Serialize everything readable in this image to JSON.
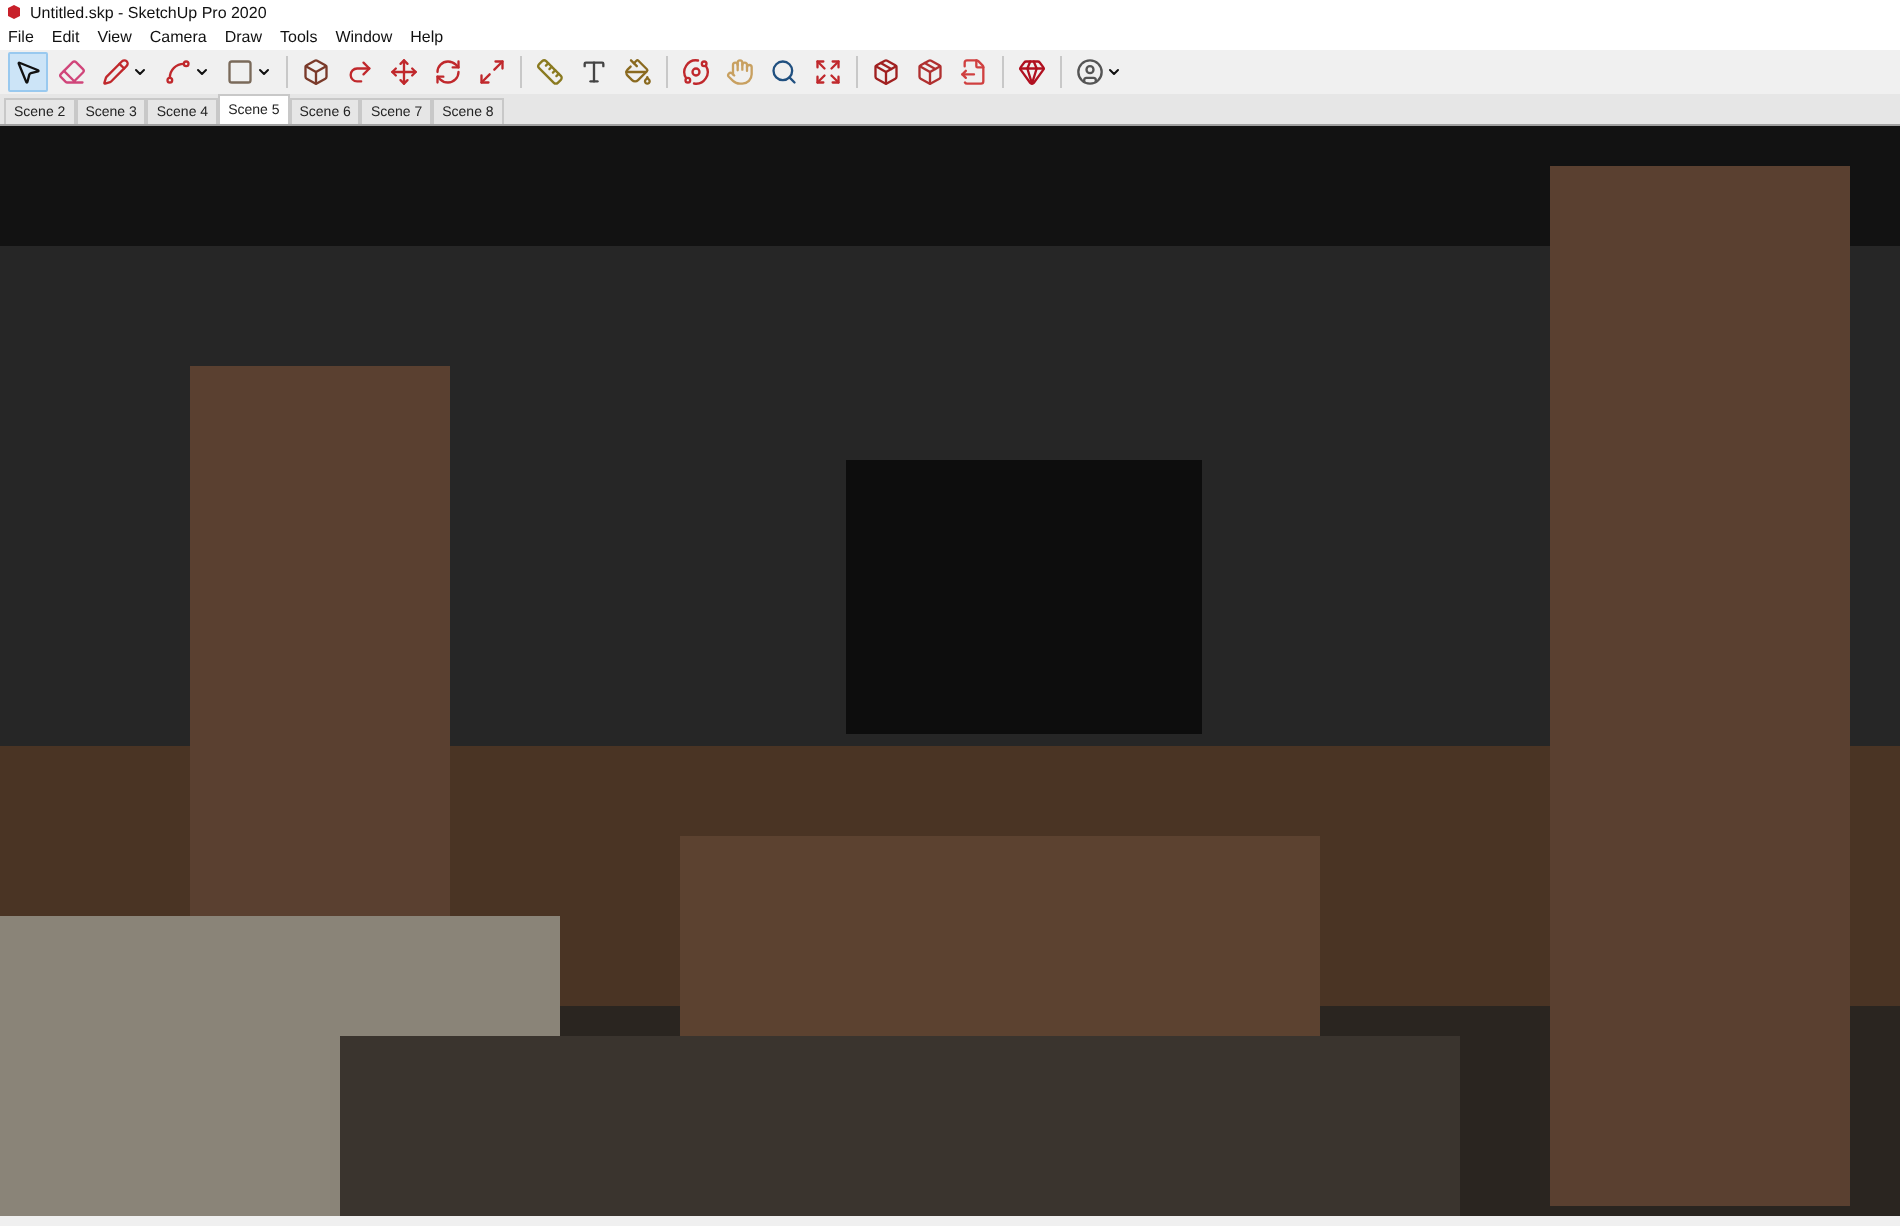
{
  "window": {
    "title": "Untitled.skp - SketchUp Pro 2020"
  },
  "menu": [
    "File",
    "Edit",
    "View",
    "Camera",
    "Draw",
    "Tools",
    "Window",
    "Help"
  ],
  "toolbar": [
    {
      "kind": "select",
      "selected": true,
      "menu": false
    },
    {
      "kind": "eraser",
      "selected": false,
      "menu": false
    },
    {
      "kind": "pencil",
      "selected": false,
      "menu": true
    },
    {
      "kind": "arc",
      "selected": false,
      "menu": true
    },
    {
      "kind": "rectangle",
      "selected": false,
      "menu": true
    },
    {
      "kind": "sep"
    },
    {
      "kind": "pushpull",
      "selected": false,
      "menu": false
    },
    {
      "kind": "followme",
      "selected": false,
      "menu": false
    },
    {
      "kind": "move",
      "selected": false,
      "menu": false
    },
    {
      "kind": "rotate",
      "selected": false,
      "menu": false
    },
    {
      "kind": "scale",
      "selected": false,
      "menu": false
    },
    {
      "kind": "sep"
    },
    {
      "kind": "tape",
      "selected": false,
      "menu": false
    },
    {
      "kind": "text",
      "selected": false,
      "menu": false
    },
    {
      "kind": "paint",
      "selected": false,
      "menu": false
    },
    {
      "kind": "sep"
    },
    {
      "kind": "orbit",
      "selected": false,
      "menu": false
    },
    {
      "kind": "pan",
      "selected": false,
      "menu": false
    },
    {
      "kind": "zoom",
      "selected": false,
      "menu": false
    },
    {
      "kind": "extents",
      "selected": false,
      "menu": false
    },
    {
      "kind": "sep"
    },
    {
      "kind": "warehouse",
      "selected": false,
      "menu": false
    },
    {
      "kind": "extension",
      "selected": false,
      "menu": false
    },
    {
      "kind": "layout",
      "selected": false,
      "menu": false
    },
    {
      "kind": "sep"
    },
    {
      "kind": "ruby",
      "selected": false,
      "menu": false
    },
    {
      "kind": "sep"
    },
    {
      "kind": "account",
      "selected": false,
      "menu": true
    }
  ],
  "scenes": [
    {
      "label": "Scene 2",
      "selected": false
    },
    {
      "label": "Scene 3",
      "selected": false
    },
    {
      "label": "Scene 4",
      "selected": false
    },
    {
      "label": "Scene 5",
      "selected": true
    },
    {
      "label": "Scene 6",
      "selected": false
    },
    {
      "label": "Scene 7",
      "selected": false
    },
    {
      "label": "Scene 8",
      "selected": false
    }
  ]
}
